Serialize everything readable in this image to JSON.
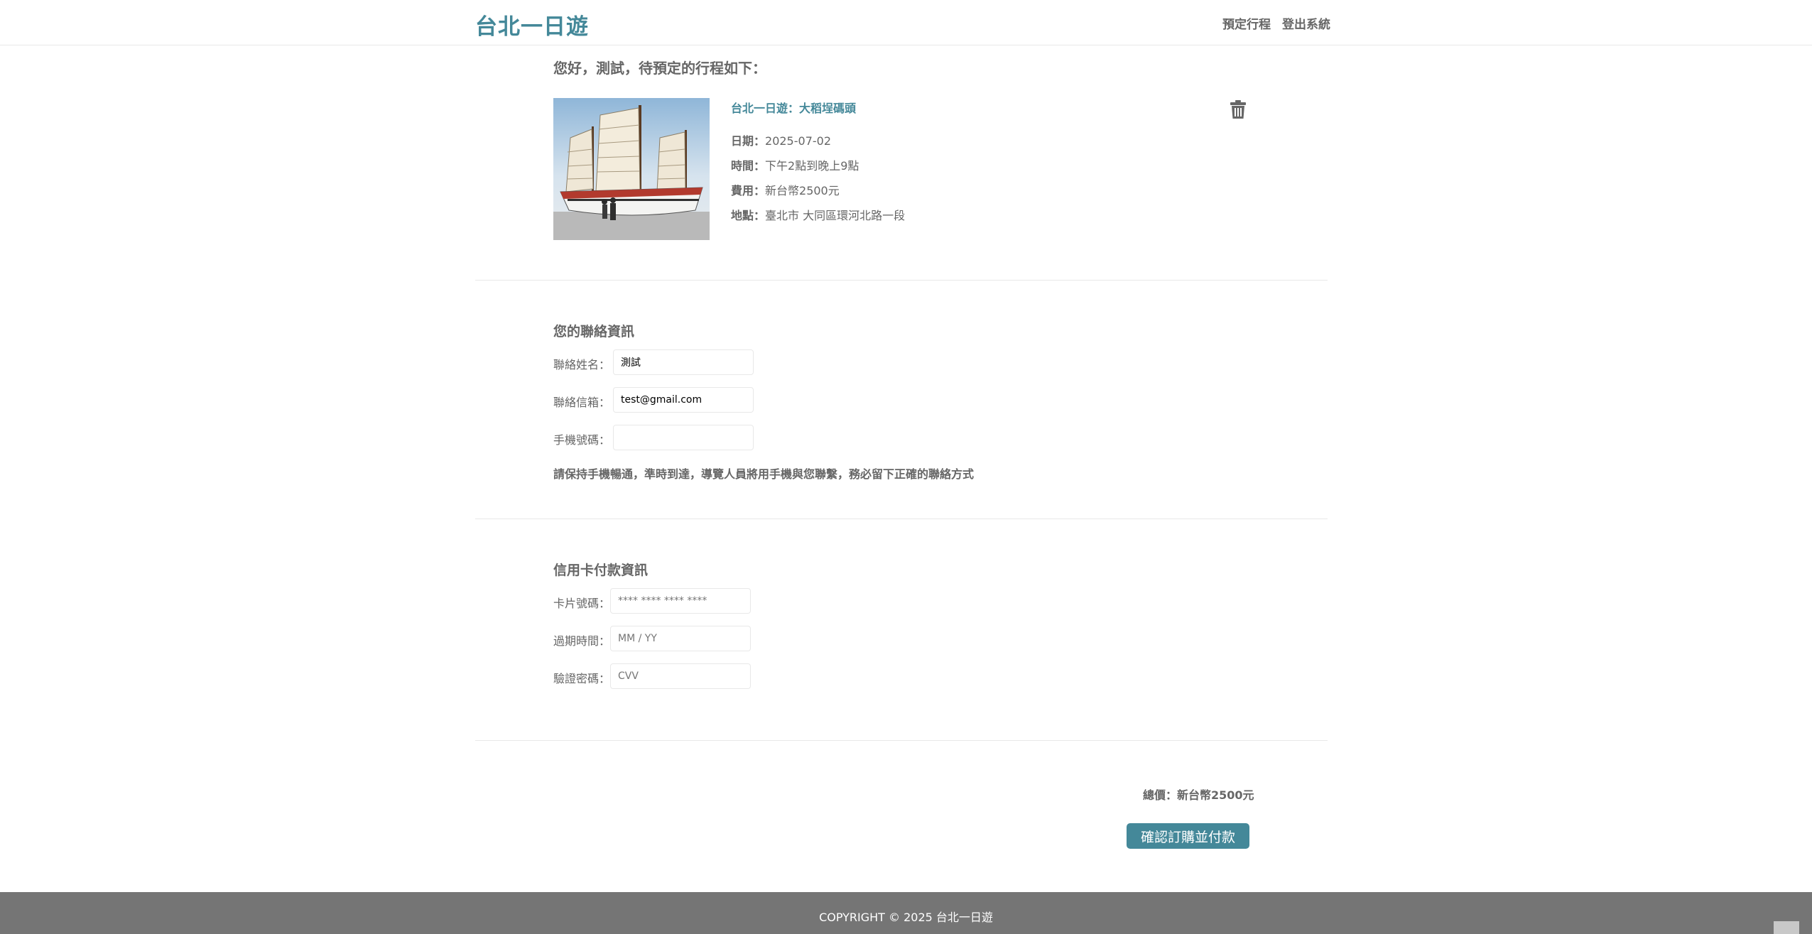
{
  "header": {
    "brand": "台北一日遊",
    "nav": {
      "book": "預定行程",
      "logout": "登出系統"
    }
  },
  "greeting": "您好，測試，待預定的行程如下：",
  "trip": {
    "title": "台北一日遊：大稻埕碼頭",
    "date_label": "日期：",
    "date": "2025-07-02",
    "time_label": "時間：",
    "time": "下午2點到晚上9點",
    "fee_label": "費用：",
    "fee": "新台幣2500元",
    "place_label": "地點：",
    "place": "臺北市 大同區環河北路一段",
    "image_icon": "sailing-junk-photo",
    "delete_icon": "trash-icon"
  },
  "contact": {
    "title": "您的聯絡資訊",
    "name_label": "聯絡姓名：",
    "name_value": "測試",
    "email_label": "聯絡信箱：",
    "email_value": "test@gmail.com",
    "phone_label": "手機號碼：",
    "phone_value": "",
    "notice": "請保持手機暢通，準時到達，導覽人員將用手機與您聯繫，務必留下正確的聯絡方式"
  },
  "payment": {
    "title": "信用卡付款資訊",
    "card_label": "卡片號碼：",
    "card_placeholder": "**** **** **** ****",
    "expiry_label": "過期時間：",
    "expiry_placeholder": "MM / YY",
    "cvv_label": "驗證密碼：",
    "cvv_placeholder": "CVV"
  },
  "summary": {
    "total": "總價：新台幣2500元",
    "confirm_button": "確認訂購並付款"
  },
  "footer": {
    "copyright": "COPYRIGHT © 2025 台北一日遊"
  },
  "colors": {
    "accent": "#448899",
    "text": "#666666",
    "footer_bg": "#757575",
    "divider": "#e8e8e8"
  }
}
